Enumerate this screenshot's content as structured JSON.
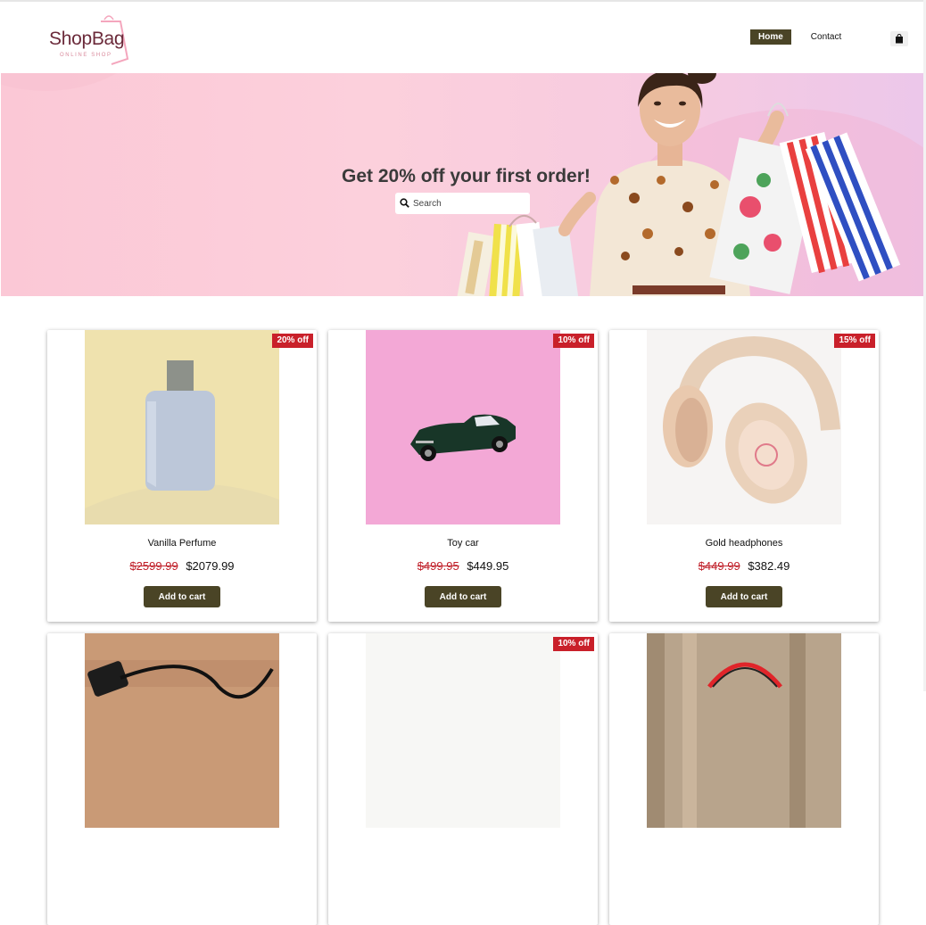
{
  "brand": {
    "name": "ShopBag",
    "tagline": "ONLINE SHOP"
  },
  "nav": {
    "home": "Home",
    "contact": "Contact"
  },
  "icons": {
    "cart": "shopping-bag-icon",
    "search": "search-icon"
  },
  "hero": {
    "title": "Get 20% off your first order!",
    "search_placeholder": "Search"
  },
  "colors": {
    "accent": "#4a4426",
    "badge": "#c9202a",
    "old_price": "#c0202a"
  },
  "products": [
    {
      "name": "Vanilla Perfume",
      "old_price": "$2599.99",
      "new_price": "$2079.99",
      "badge": "20% off",
      "button": "Add to cart"
    },
    {
      "name": "Toy car",
      "old_price": "$499.95",
      "new_price": "$449.95",
      "badge": "10% off",
      "button": "Add to cart"
    },
    {
      "name": "Gold headphones",
      "old_price": "$449.99",
      "new_price": "$382.49",
      "badge": "15% off",
      "button": "Add to cart"
    },
    {
      "name": "",
      "badge": ""
    },
    {
      "name": "",
      "badge": "10% off"
    },
    {
      "name": "",
      "badge": ""
    }
  ]
}
